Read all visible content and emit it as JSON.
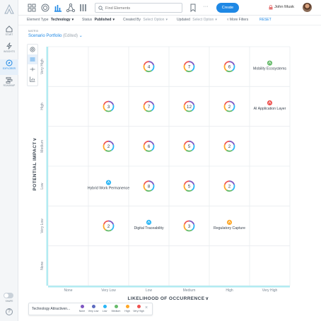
{
  "rail": {
    "items": [
      {
        "label": "Start"
      },
      {
        "label": "Insights"
      },
      {
        "label": "Explorer"
      },
      {
        "label": "Roadmap"
      }
    ],
    "toggle_label": "Shape",
    "help_label": "?"
  },
  "topbar": {
    "search_placeholder": "Find Elements",
    "create_label": "Create",
    "more_label": "···",
    "user_name": "John Musk"
  },
  "filters": {
    "element_type_label": "Element Type",
    "element_type_value": "Technology",
    "status_label": "Status",
    "status_value": "Published",
    "created_by_label": "Created By",
    "created_by_value": "Select Option",
    "updated_label": "Updated",
    "updated_value": "Select Option",
    "more_filters_label": "More Filters",
    "reset_label": "RESET"
  },
  "header": {
    "crumb": "MATRIX",
    "title": "Scenario Portfolio",
    "edited": "(Edited)"
  },
  "chart_data": {
    "type": "scatter",
    "xlabel": "LIKELIHOOD OF OCCURRENCE",
    "ylabel": "POTENTIAL IMPACT",
    "x_categories": [
      "None",
      "Very Low",
      "Low",
      "Medium",
      "High",
      "Very High"
    ],
    "y_categories": [
      "None",
      "Very Low",
      "Low",
      "Medium",
      "High",
      "Very High"
    ],
    "cells": [
      {
        "x": "Low",
        "y": "Very High",
        "count": "4"
      },
      {
        "x": "Medium",
        "y": "Very High",
        "count": "7"
      },
      {
        "x": "High",
        "y": "Very High",
        "count": "6"
      },
      {
        "x": "Very Low",
        "y": "High",
        "count": "3"
      },
      {
        "x": "Low",
        "y": "High",
        "count": "7"
      },
      {
        "x": "Medium",
        "y": "High",
        "count": "12"
      },
      {
        "x": "High",
        "y": "High",
        "count": "2"
      },
      {
        "x": "Very Low",
        "y": "Medium",
        "count": "2"
      },
      {
        "x": "Low",
        "y": "Medium",
        "count": "6"
      },
      {
        "x": "Medium",
        "y": "Medium",
        "count": "5"
      },
      {
        "x": "High",
        "y": "Medium",
        "count": "2"
      },
      {
        "x": "Low",
        "y": "Low",
        "count": "8"
      },
      {
        "x": "Medium",
        "y": "Low",
        "count": "5"
      },
      {
        "x": "High",
        "y": "Low",
        "count": "2"
      },
      {
        "x": "Very Low",
        "y": "Very Low",
        "count": "2"
      },
      {
        "x": "Medium",
        "y": "Very Low",
        "count": "3"
      }
    ],
    "elements": [
      {
        "x": "Very High",
        "y": "Very High",
        "label": "Mobility Ecosystems",
        "level": "Medium"
      },
      {
        "x": "Very High",
        "y": "High",
        "label": "AI Application Layer",
        "level": "Very High"
      },
      {
        "x": "Very Low",
        "y": "Low",
        "label": "Hybrid Work Permanence",
        "level": "Low"
      },
      {
        "x": "Low",
        "y": "Very Low",
        "label": "Digital Traceability",
        "level": "Low"
      },
      {
        "x": "High",
        "y": "Very Low",
        "label": "Regulatory Capture",
        "level": "High"
      }
    ],
    "legend": {
      "title": "Technology Attractiven...",
      "placement": "bottom-left",
      "items": [
        {
          "label": "None",
          "color": "#7e57c2"
        },
        {
          "label": "Very Low",
          "color": "#5c6bc0"
        },
        {
          "label": "Low",
          "color": "#29b6f6"
        },
        {
          "label": "Medium",
          "color": "#66bb6a"
        },
        {
          "label": "High",
          "color": "#ffa726"
        },
        {
          "label": "Very High",
          "color": "#ef5350"
        }
      ]
    },
    "grid": true
  },
  "colors": {
    "accent": "#1e88e5",
    "ring": [
      "#7e57c2",
      "#29b6f6",
      "#66bb6a",
      "#ffa726",
      "#ef5350"
    ]
  },
  "icons": {
    "rail": [
      "start-icon",
      "insights-icon",
      "explorer-icon",
      "roadmap-icon"
    ],
    "topbar": [
      "dashboard-icon",
      "target-icon",
      "bar-chart-icon",
      "network-icon",
      "gantt-icon",
      "search-icon",
      "bookmark-icon",
      "lock-icon"
    ],
    "viewtools": [
      "bubble-view-icon",
      "matrix-view-icon",
      "timeline-view-icon",
      "chart-view-icon"
    ]
  }
}
